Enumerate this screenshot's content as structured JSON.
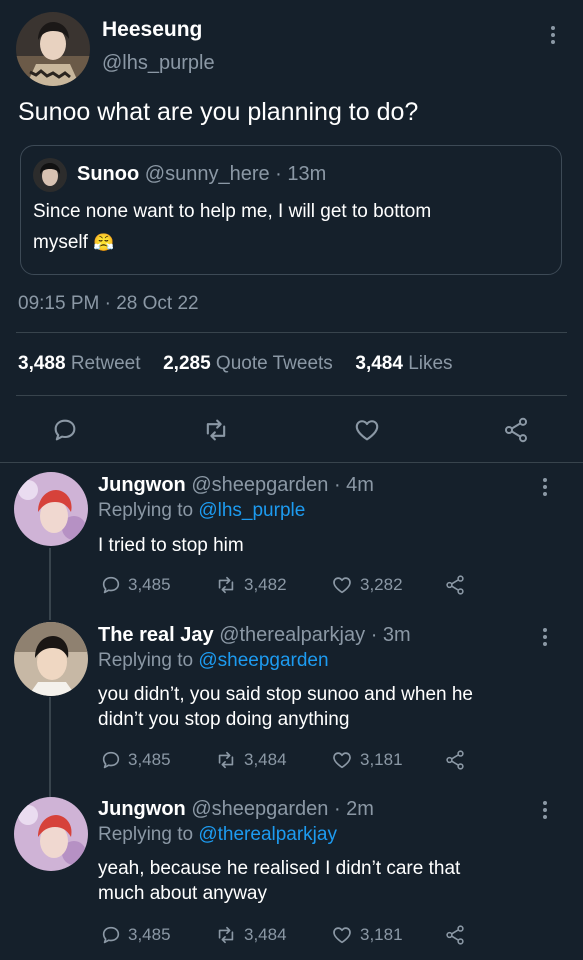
{
  "main_tweet": {
    "author_name": "Heeseung",
    "author_handle": "@lhs_purple",
    "text": "Sunoo what are you planning to do?",
    "quote": {
      "author_name": "Sunoo",
      "author_handle": "@sunny_here",
      "time": "· 13m",
      "text_line1": "Since none want to help me, I will get to bottom",
      "text_line2": "myself",
      "emoji": "😤"
    },
    "timestamp": "09:15 PM · 28 Oct 22",
    "stats": {
      "retweets_count": "3,488",
      "retweets_label": "Retweet",
      "quotes_count": "2,285",
      "quotes_label": "Quote Tweets",
      "likes_count": "3,484",
      "likes_label": "Likes"
    }
  },
  "replies": [
    {
      "author_name": "Jungwon",
      "author_handle": "@sheepgarden",
      "time": "· 4m",
      "replying_label": "Replying to",
      "replying_handle": "@lhs_purple",
      "text_line1": "I tried to stop him",
      "text_line2": "",
      "replies": "3,485",
      "retweets": "3,482",
      "likes": "3,282"
    },
    {
      "author_name": "The real Jay",
      "author_handle": "@therealparkjay",
      "time": "· 3m",
      "replying_label": "Replying to",
      "replying_handle": "@sheepgarden",
      "text_line1": "you didn’t, you said stop sunoo and when he",
      "text_line2": "didn’t you stop doing anything",
      "replies": "3,485",
      "retweets": "3,484",
      "likes": "3,181"
    },
    {
      "author_name": "Jungwon",
      "author_handle": "@sheepgarden",
      "time": "· 2m",
      "replying_label": "Replying to",
      "replying_handle": "@therealparkjay",
      "text_line1": "yeah, because he realised I didn’t care that",
      "text_line2": "much about anyway",
      "replies": "3,485",
      "retweets": "3,484",
      "likes": "3,181"
    }
  ],
  "colors": {
    "background": "#15202b",
    "muted": "#8b98a5",
    "link": "#1d9bf0",
    "divider": "#38444d"
  }
}
